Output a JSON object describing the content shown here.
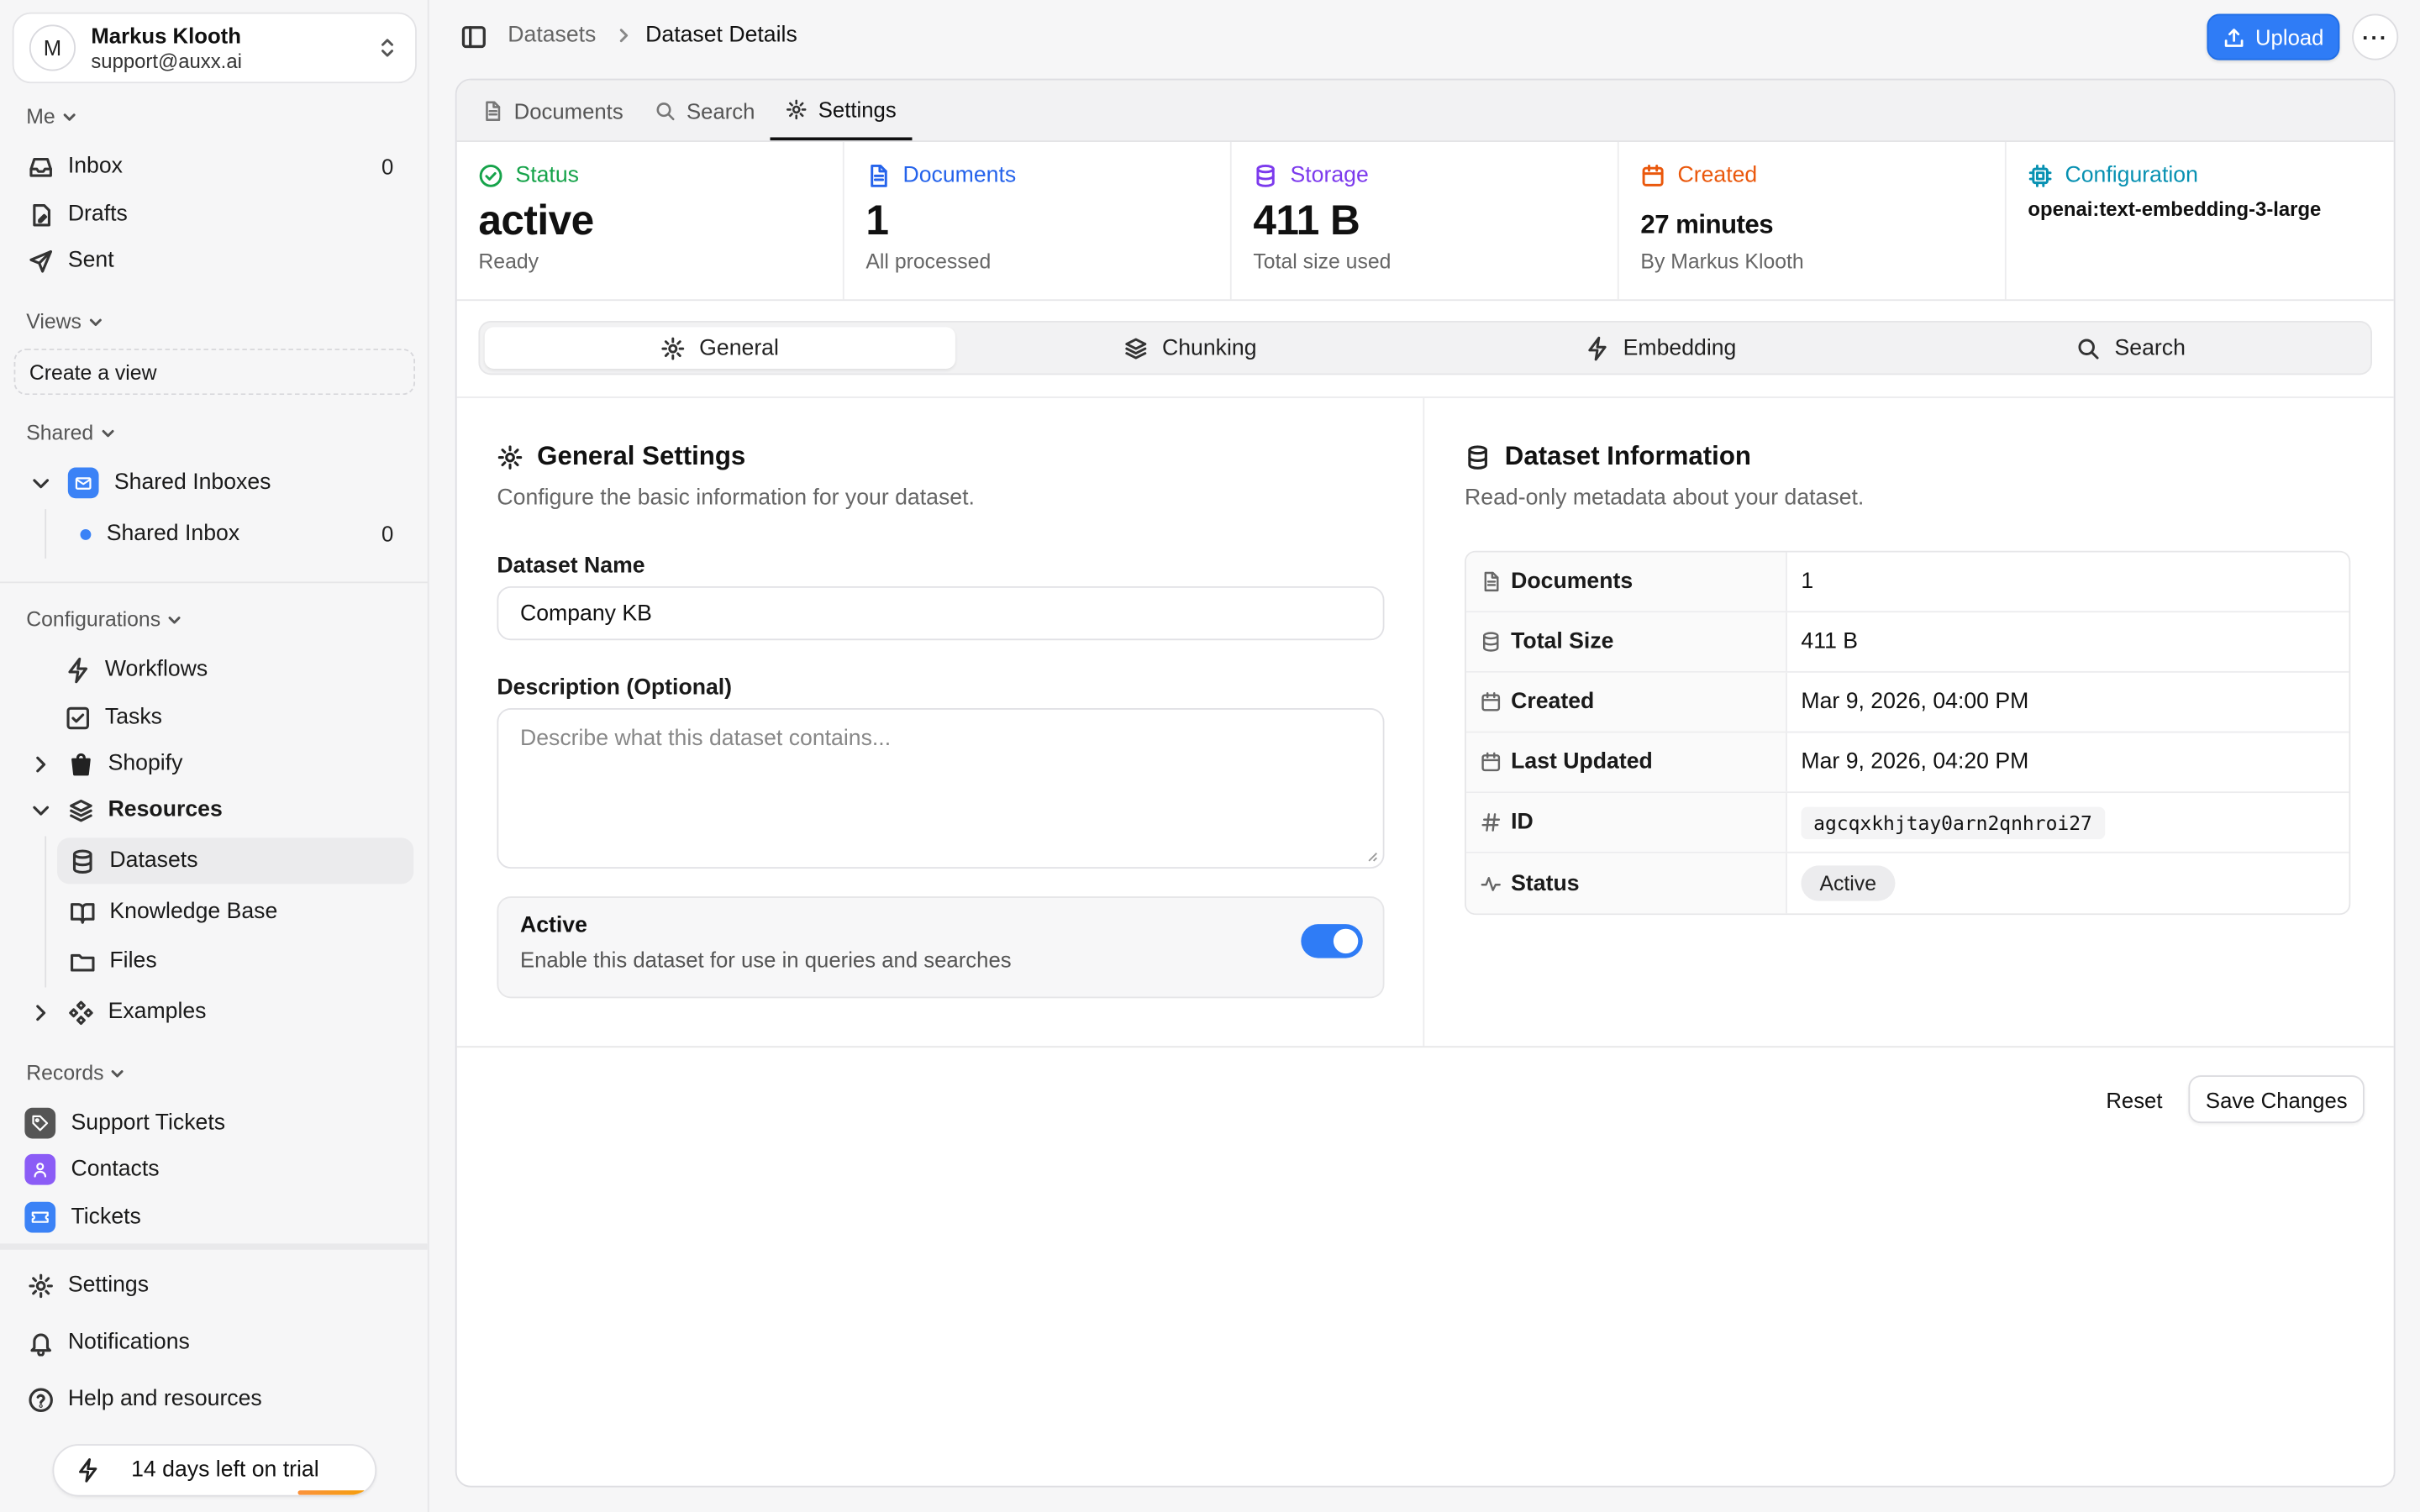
{
  "user": {
    "initial": "M",
    "name": "Markus Klooth",
    "email": "support@auxx.ai"
  },
  "sidebar": {
    "me_label": "Me",
    "inbox": {
      "label": "Inbox",
      "count": "0"
    },
    "drafts": "Drafts",
    "sent": "Sent",
    "views_label": "Views",
    "create_view": "Create a view",
    "shared_label": "Shared",
    "shared_inboxes": "Shared Inboxes",
    "shared_inbox": {
      "label": "Shared Inbox",
      "count": "0"
    },
    "configurations_label": "Configurations",
    "workflows": "Workflows",
    "tasks": "Tasks",
    "shopify": "Shopify",
    "resources": "Resources",
    "datasets": "Datasets",
    "knowledge_base": "Knowledge Base",
    "files": "Files",
    "examples": "Examples",
    "records_label": "Records",
    "support_tickets": "Support Tickets",
    "contacts": "Contacts",
    "tickets": "Tickets",
    "settings": "Settings",
    "notifications": "Notifications",
    "help": "Help and resources",
    "trial": "14 days left on trial"
  },
  "breadcrumb": {
    "parent": "Datasets",
    "current": "Dataset Details"
  },
  "header": {
    "upload_label": "Upload",
    "more_label": "···"
  },
  "panel_tabs": [
    {
      "label": "Documents",
      "icon": "file-icon"
    },
    {
      "label": "Search",
      "icon": "search-icon"
    },
    {
      "label": "Settings",
      "icon": "gear-icon",
      "active": true
    }
  ],
  "stats": {
    "status": {
      "label": "Status",
      "value": "active",
      "sub": "Ready",
      "color": "#16a34a"
    },
    "documents": {
      "label": "Documents",
      "value": "1",
      "sub": "All processed",
      "color": "#2563eb"
    },
    "storage": {
      "label": "Storage",
      "value": "411 B",
      "sub": "Total size used",
      "color": "#7c3aed"
    },
    "created": {
      "label": "Created",
      "value": "27 minutes",
      "sub": "By Markus Klooth",
      "color": "#ea580c"
    },
    "configuration": {
      "label": "Configuration",
      "value": "openai:text-embedding-3-large",
      "color": "#0891b2"
    }
  },
  "sub_tabs": [
    {
      "label": "General",
      "active": true
    },
    {
      "label": "Chunking"
    },
    {
      "label": "Embedding"
    },
    {
      "label": "Search"
    }
  ],
  "general": {
    "title": "General Settings",
    "description": "Configure the basic information for your dataset.",
    "name_label": "Dataset Name",
    "name_value": "Company KB",
    "desc_label": "Description (Optional)",
    "desc_placeholder": "Describe what this dataset contains...",
    "active_title": "Active",
    "active_desc": "Enable this dataset for use in queries and searches",
    "active_on": true
  },
  "info": {
    "title": "Dataset Information",
    "description": "Read-only metadata about your dataset.",
    "rows": [
      {
        "key": "Documents",
        "value": "1"
      },
      {
        "key": "Total Size",
        "value": "411 B"
      },
      {
        "key": "Created",
        "value": "Mar 9, 2026, 04:00 PM"
      },
      {
        "key": "Last Updated",
        "value": "Mar 9, 2026, 04:20 PM"
      },
      {
        "key": "ID",
        "value": "agcqxkhjtay0arn2qnhroi27"
      },
      {
        "key": "Status",
        "value": "Active"
      }
    ]
  },
  "actions": {
    "reset": "Reset",
    "save": "Save Changes"
  },
  "colors": {
    "accent": "#2f7cf6"
  }
}
